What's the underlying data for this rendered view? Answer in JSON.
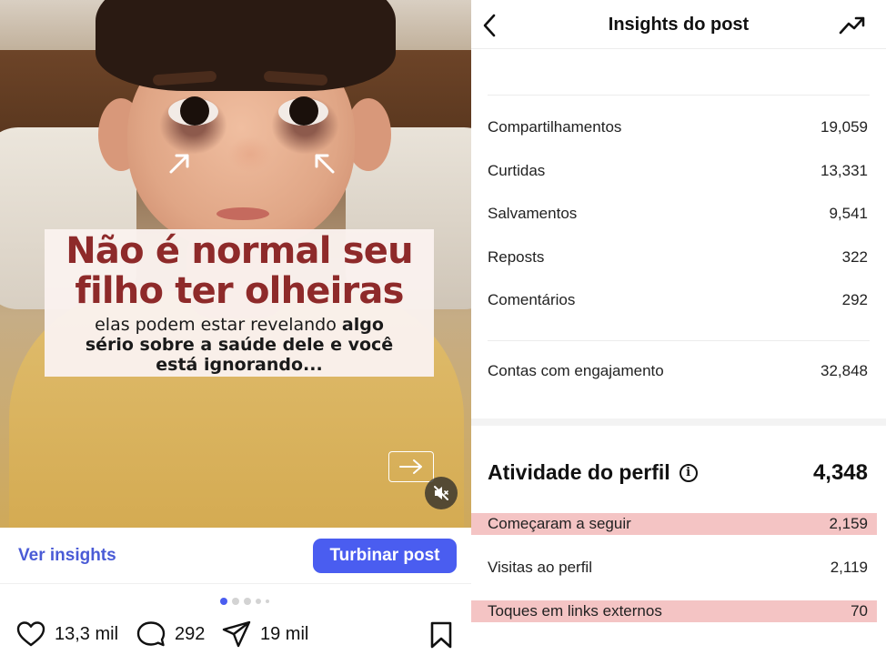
{
  "post": {
    "headline_line1": "Não é normal seu",
    "headline_line2": "filho ter olheiras",
    "sub_normal": "elas podem estar revelando ",
    "sub_bold": "algo sério sobre a saúde dele e você está ignorando...",
    "ver_insights": "Ver insights",
    "turbinar": "Turbinar post",
    "likes": "13,3 mil",
    "comments": "292",
    "shares": "19 mil"
  },
  "insights": {
    "title": "Insights do post",
    "interactions": [
      {
        "label": "Compartilhamentos",
        "value": "19,059"
      },
      {
        "label": "Curtidas",
        "value": "13,331"
      },
      {
        "label": "Salvamentos",
        "value": "9,541"
      },
      {
        "label": "Reposts",
        "value": "322"
      },
      {
        "label": "Comentários",
        "value": "292"
      }
    ],
    "accounts_engaged": {
      "label": "Contas com engajamento",
      "value": "32,848"
    },
    "profile_activity": {
      "title": "Atividade do perfil",
      "value": "4,348",
      "rows": [
        {
          "label": "Começaram a seguir",
          "value": "2,159",
          "highlight": true
        },
        {
          "label": "Visitas ao perfil",
          "value": "2,119",
          "highlight": false
        },
        {
          "label": "Toques em links externos",
          "value": "70",
          "highlight": true
        }
      ]
    }
  },
  "colors": {
    "accent": "#4a5df0",
    "headline": "#8e2a2a",
    "highlight": "#f4c4c4"
  },
  "icons": [
    "arrow-right-icon",
    "mute-icon",
    "heart-icon",
    "comment-icon",
    "send-icon",
    "bookmark-icon",
    "back-chevron-icon",
    "trending-icon",
    "info-icon"
  ]
}
